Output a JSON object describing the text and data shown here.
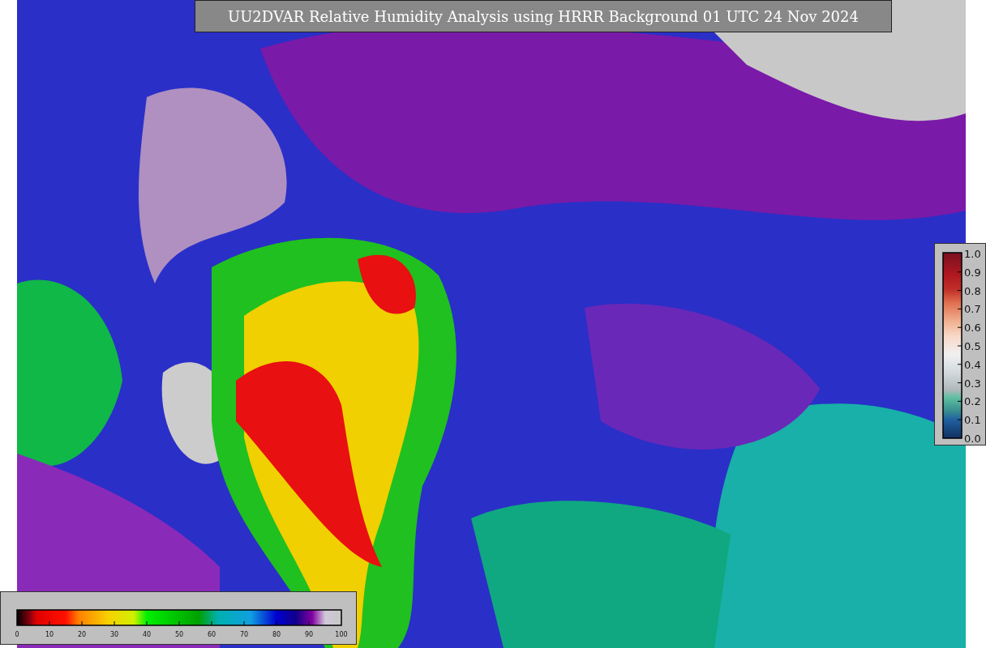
{
  "title": "UU2DVAR Relative Humidity Analysis using HRRR Background 01 UTC 24 Nov 2024",
  "horizontal_colorbar": {
    "ticks": [
      "0",
      "10",
      "20",
      "30",
      "40",
      "50",
      "60",
      "70",
      "80",
      "90",
      "100"
    ]
  },
  "vertical_colorbar": {
    "ticks": [
      "1.0",
      "0.9",
      "0.8",
      "0.7",
      "0.6",
      "0.5",
      "0.4",
      "0.3",
      "0.2",
      "0.1",
      "0.0"
    ]
  }
}
